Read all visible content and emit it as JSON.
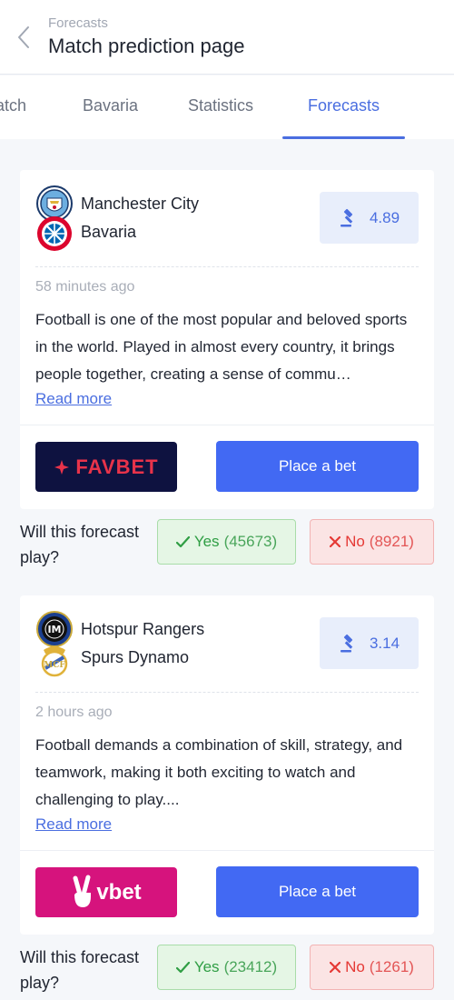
{
  "header": {
    "breadcrumb": "Forecasts",
    "title": "Match prediction page"
  },
  "tabs": [
    {
      "label": "Match"
    },
    {
      "label": "Bavaria"
    },
    {
      "label": "Statistics"
    },
    {
      "label": "Forecasts",
      "active": true
    }
  ],
  "forecasts": [
    {
      "team_home": "Manchester City",
      "team_away": "Bavaria",
      "team_home_logo": "manchester-city-crest-icon",
      "team_away_logo": "bayern-munich-crest-icon",
      "odds": "4.89",
      "timestamp": "58 minutes ago",
      "description": "Football is one of the most popular and beloved sports in the world. Played in almost every country, it brings people together, creating a sense of commu…",
      "read_more": "Read more",
      "brand": "FAVBET",
      "place_bet": "Place a bet",
      "vote_question": "Will this forecast play?",
      "yes_label": "Yes",
      "yes_count": "(45673)",
      "no_label": "No",
      "no_count": "(8921)"
    },
    {
      "team_home": "Hotspur Rangers",
      "team_away": "Spurs Dynamo",
      "team_home_logo": "inter-milan-crest-icon",
      "team_away_logo": "real-madrid-crest-icon",
      "odds": "3.14",
      "timestamp": "2 hours ago",
      "description": "Football demands a combination of skill, strategy, and teamwork, making it both exciting to watch and challenging to play....",
      "read_more": "Read more",
      "brand": "vbet",
      "place_bet": "Place a bet",
      "vote_question": "Will this forecast play?",
      "yes_label": "Yes",
      "yes_count": "(23412)",
      "no_label": "No",
      "no_count": "(1261)"
    }
  ],
  "colors": {
    "accent": "#4a6ee0",
    "primary_button": "#4269f3",
    "favbet_bg": "#0e1240",
    "favbet_text": "#e8334a",
    "vbet_bg": "#d6137d",
    "yes_green": "#2f9e44",
    "no_red": "#e53935"
  }
}
